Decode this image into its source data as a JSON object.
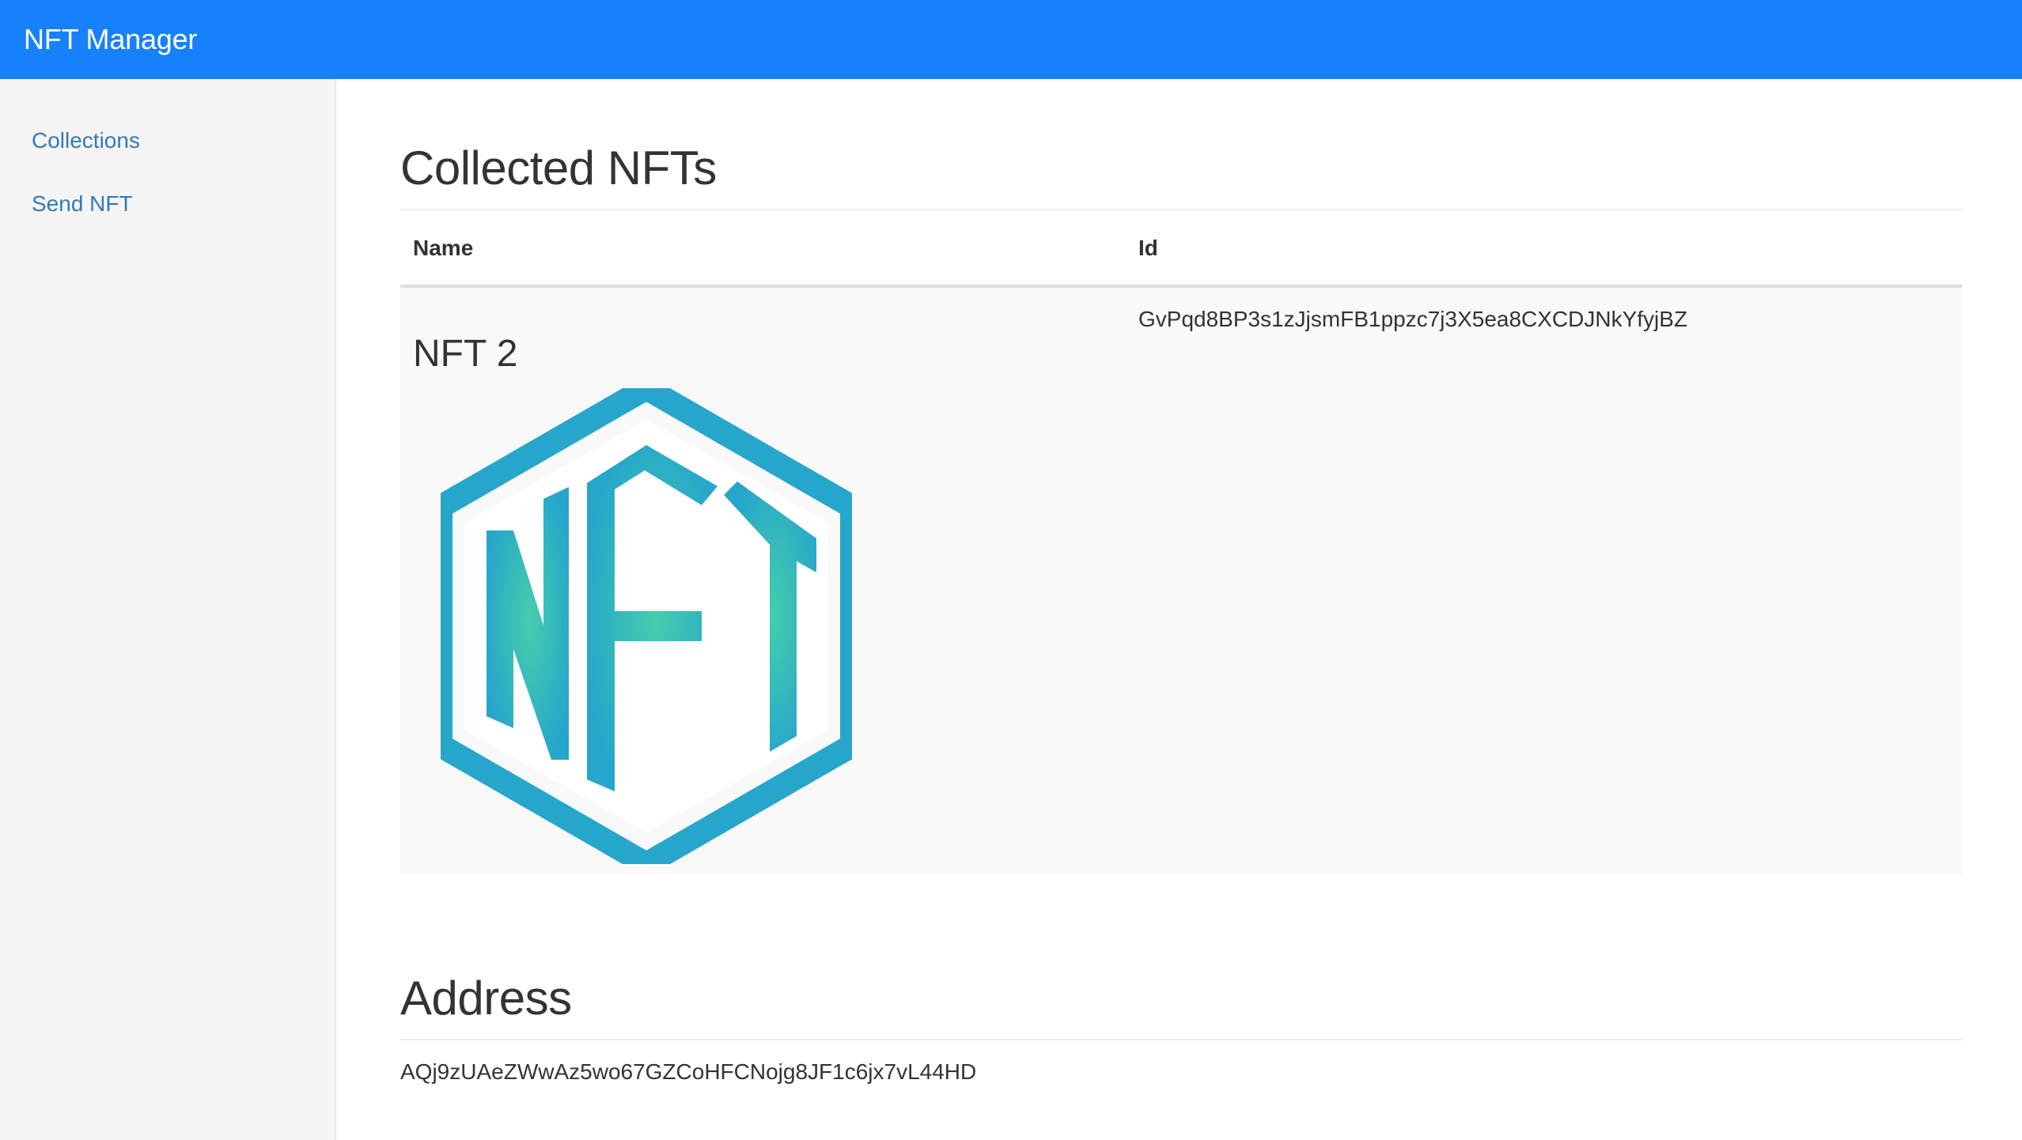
{
  "app": {
    "brand": "NFT Manager",
    "accent_color": "#1781fc"
  },
  "sidebar": {
    "items": [
      {
        "label": "Collections"
      },
      {
        "label": "Send NFT"
      }
    ]
  },
  "collected": {
    "title": "Collected NFTs",
    "columns": [
      "Name",
      "Id"
    ],
    "rows": [
      {
        "name": "NFT 2",
        "id": "GvPqd8BP3s1zJjsmFB1ppzc7j3X5ea8CXCDJNkYfyjBZ",
        "image": "nft-logo"
      }
    ]
  },
  "address": {
    "title": "Address",
    "value": "AQj9zUAeZWwAz5wo67GZCoHFCNojg8JF1c6jx7vL44HD"
  }
}
